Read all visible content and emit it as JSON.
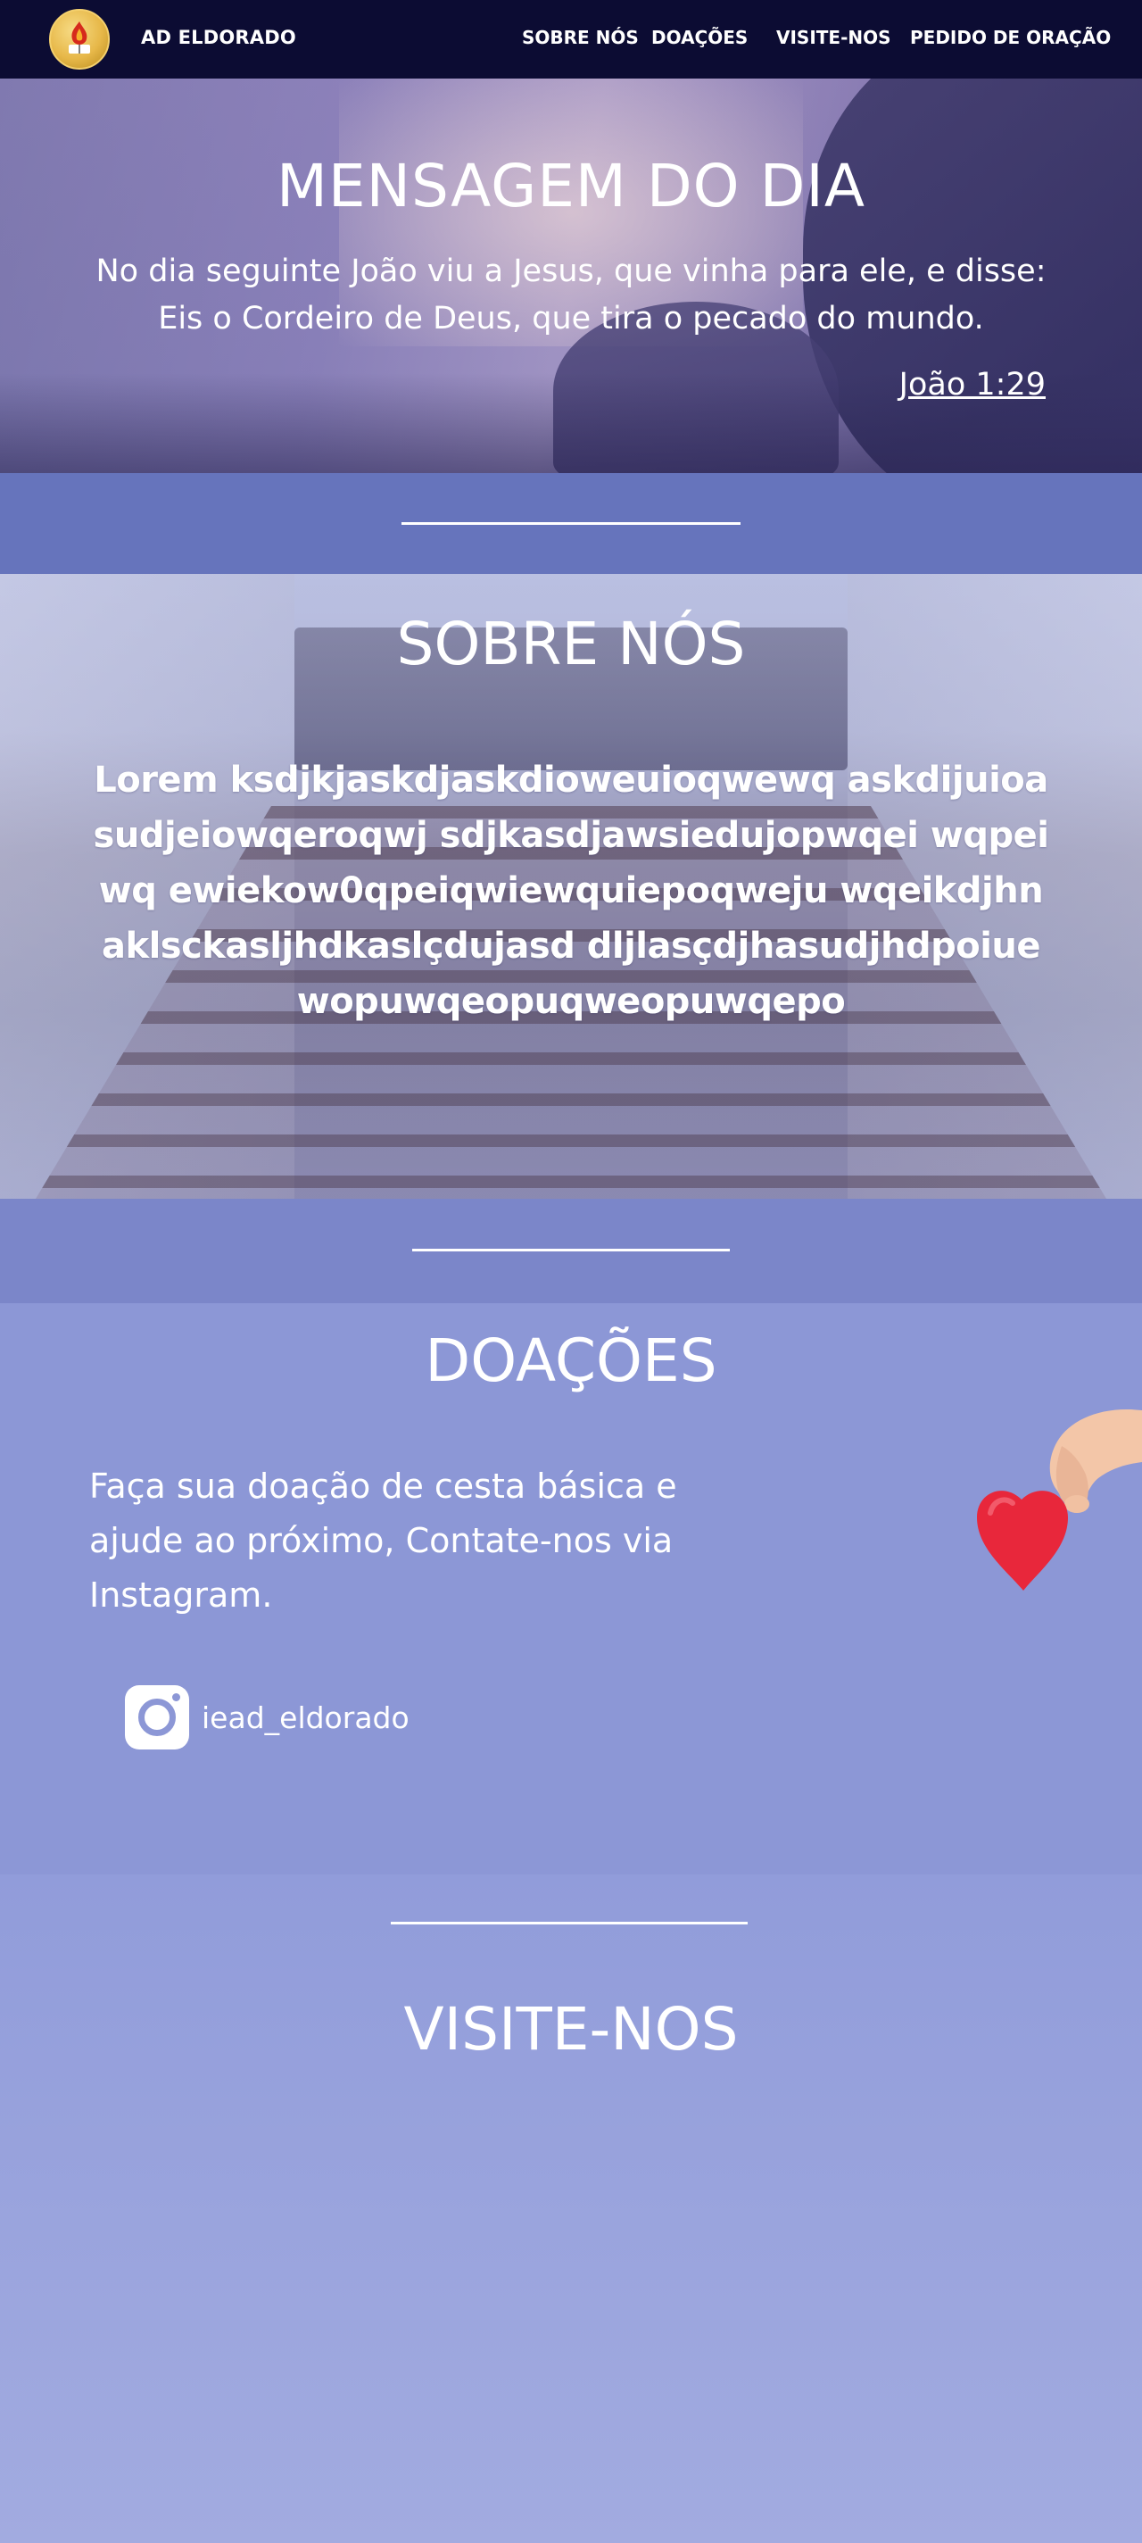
{
  "navbar": {
    "brand": "AD ELDORADO",
    "links": [
      {
        "label": "SOBRE NÓS"
      },
      {
        "label": "DOAÇÕES"
      },
      {
        "label": "VISITE-NOS"
      },
      {
        "label": "PEDIDO DE ORAÇÃO"
      }
    ]
  },
  "hero": {
    "title": "MENSAGEM DO DIA",
    "verse": "No dia seguinte João viu a Jesus, que vinha para ele, e disse: Eis o Cordeiro de Deus, que tira o pecado do mundo.",
    "reference": "João 1:29"
  },
  "about": {
    "title": "SOBRE NÓS",
    "text": "Lorem ksdjkjaskdjaskdioweuioqwewq askdijuioasudjeiowqeroqwj sdjkasdjawsiedujopwqei wqpeiwq ewiekow0qpeiqwiewquiepoqweju wqeikdjhnaklsckasljhdkaslçdujasd dljlasçdjhasudjhdpoiuewopuwqeopuqweopuwqepo"
  },
  "donations": {
    "title": "DOAÇÕES",
    "text": "Faça sua doação de cesta básica e ajude ao próximo, Contate-nos via Instagram.",
    "instagram_handle": "iead_eldorado",
    "icons": [
      "instagram-icon",
      "heart-hand-image"
    ]
  },
  "visit": {
    "title": "VISITE-NOS"
  },
  "colors": {
    "navbar": "#0c0c33",
    "band1": "#6674bc",
    "band2": "#7b86c9",
    "donate_bg": "#8c97d6",
    "heart": "#e8273b"
  }
}
